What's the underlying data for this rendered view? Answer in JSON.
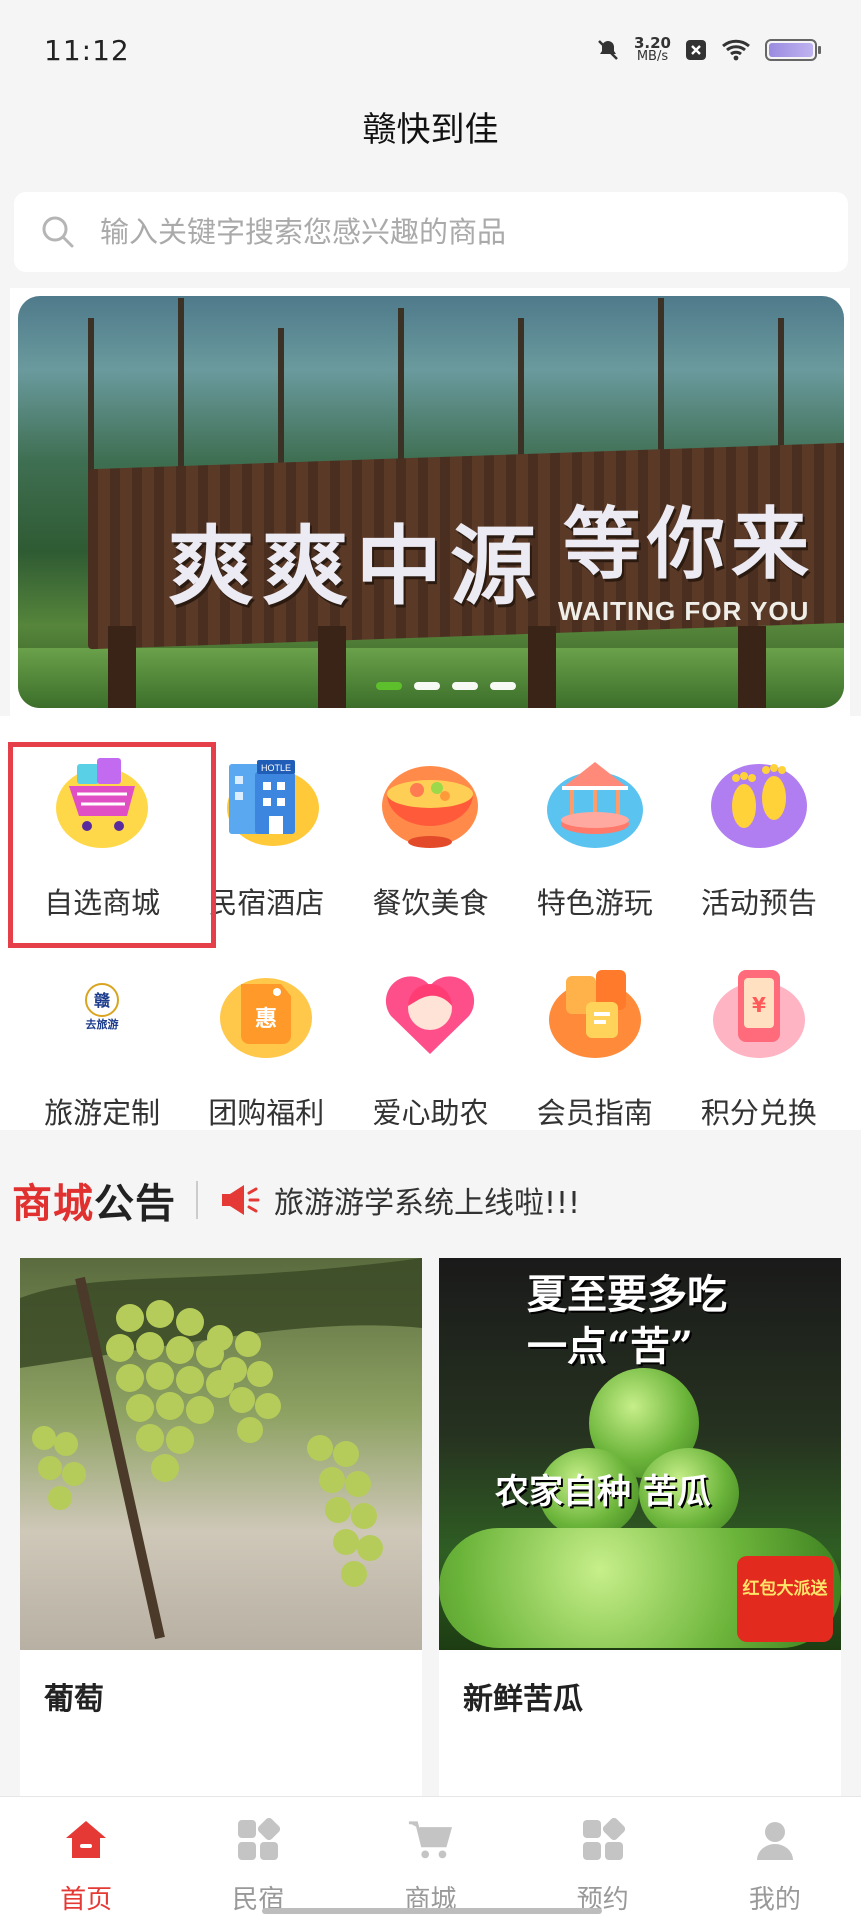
{
  "status_bar": {
    "time": "11:12",
    "net_speed_value": "3.20",
    "net_speed_unit": "MB/s"
  },
  "app": {
    "title": "赣快到佳"
  },
  "search": {
    "placeholder": "输入关键字搜索您感兴趣的商品"
  },
  "banner": {
    "sign_main": "爽爽中源",
    "sign_right": "等你来",
    "sign_english": "WAITING FOR YOU",
    "active_slide": 1,
    "slide_count": 4
  },
  "categories": [
    {
      "label": "自选商城",
      "icon": "shopping-cart-icon"
    },
    {
      "label": "民宿酒店",
      "icon": "hotel-icon"
    },
    {
      "label": "餐饮美食",
      "icon": "food-bowl-icon"
    },
    {
      "label": "特色游玩",
      "icon": "carousel-icon"
    },
    {
      "label": "活动预告",
      "icon": "footprints-icon"
    },
    {
      "label": "旅游定制",
      "icon": "travel-logo-icon"
    },
    {
      "label": "团购福利",
      "icon": "discount-tag-icon"
    },
    {
      "label": "爱心助农",
      "icon": "heart-avatar-icon"
    },
    {
      "label": "会员指南",
      "icon": "member-cards-icon"
    },
    {
      "label": "积分兑换",
      "icon": "points-phone-icon"
    }
  ],
  "category_logo_text": "去旅游",
  "notice": {
    "title_a": "商城",
    "title_b": "公告",
    "text": "旅游游学系统上线啦!!!"
  },
  "products": [
    {
      "name": "葡萄",
      "price_partial": "¥"
    },
    {
      "name": "新鲜苦瓜",
      "price_partial": "¥",
      "caption_1": "夏至要多吃",
      "caption_2": "一点“苦”",
      "caption_3": "农家自种 苦瓜",
      "badge": "红包大派送"
    }
  ],
  "nav": [
    {
      "label": "首页",
      "icon": "home-icon",
      "active": true
    },
    {
      "label": "民宿",
      "icon": "grid-apps-icon",
      "active": false
    },
    {
      "label": "商城",
      "icon": "cart-icon",
      "active": false
    },
    {
      "label": "预约",
      "icon": "grid-apps-icon",
      "active": false
    },
    {
      "label": "我的",
      "icon": "user-icon",
      "active": false
    }
  ],
  "colors": {
    "accent_red": "#e53935",
    "highlight_box": "#e5404a",
    "active_dot": "#5dbf2b"
  }
}
